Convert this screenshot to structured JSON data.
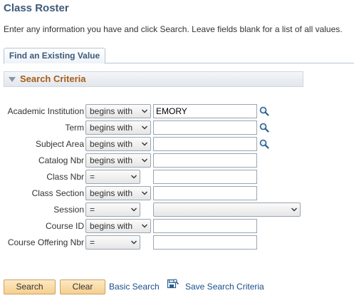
{
  "page": {
    "title": "Class Roster",
    "instructions": "Enter any information you have and click Search. Leave fields blank for a list of all values."
  },
  "tabs": [
    {
      "label": "Find an Existing Value"
    }
  ],
  "search_criteria": {
    "title": "Search Criteria",
    "fields": [
      {
        "label": "Academic Institution",
        "operator": "begins with",
        "value": "EMORY",
        "lookup_icon": "magnifier-icon"
      },
      {
        "label": "Term",
        "operator": "begins with",
        "value": "",
        "lookup_icon": "magnifier-icon"
      },
      {
        "label": "Subject Area",
        "operator": "begins with",
        "value": "",
        "lookup_icon": "magnifier-icon"
      },
      {
        "label": "Catalog Nbr",
        "operator": "begins with",
        "value": ""
      },
      {
        "label": "Class Nbr",
        "operator": "=",
        "value": ""
      },
      {
        "label": "Class Section",
        "operator": "begins with",
        "value": ""
      },
      {
        "label": "Session",
        "operator": "=",
        "value": ""
      },
      {
        "label": "Course ID",
        "operator": "begins with",
        "value": ""
      },
      {
        "label": "Course Offering Nbr",
        "operator": "=",
        "value": ""
      }
    ]
  },
  "actions": {
    "search_label": "Search",
    "clear_label": "Clear",
    "basic_search_label": "Basic Search",
    "save_search_label": "Save Search Criteria",
    "save_icon": "save-criteria-icon"
  },
  "colors": {
    "title": "#3d5a7a",
    "section_title": "#a65d1a",
    "link": "#1a4f8b",
    "button_bg": "#f6cf8e"
  }
}
